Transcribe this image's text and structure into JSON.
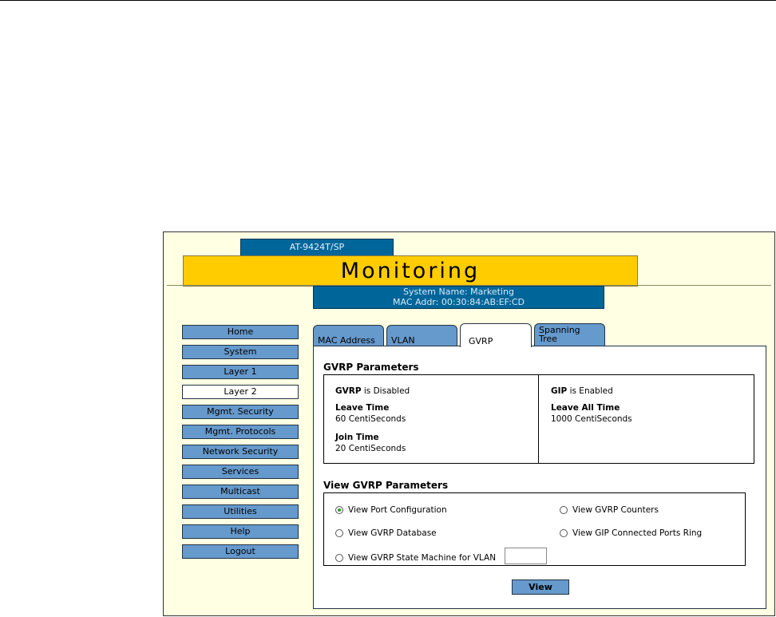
{
  "header": {
    "model": "AT-9424T/SP",
    "title": "Monitoring",
    "system_name": "System Name: Marketing",
    "mac_addr": "MAC Addr: 00:30:84:AB:EF:CD"
  },
  "nav": {
    "items": [
      "Home",
      "System",
      "Layer 1",
      "Layer 2",
      "Mgmt. Security",
      "Mgmt. Protocols",
      "Network Security",
      "Services",
      "Multicast",
      "Utilities",
      "Help",
      "Logout"
    ],
    "active": "Layer 2"
  },
  "tabs": {
    "mac_address": "MAC Address",
    "vlan": "VLAN",
    "gvrp": "GVRP",
    "spanning_tree_1": "Spanning",
    "spanning_tree_2": "Tree",
    "active": "GVRP"
  },
  "gvrp_params": {
    "title": "GVRP Parameters",
    "gvrp_label": "GVRP",
    "gvrp_status": "is Disabled",
    "leave_time_label": "Leave Time",
    "leave_time_value": "60 CentiSeconds",
    "join_time_label": "Join Time",
    "join_time_value": "20 CentiSeconds",
    "gip_label": "GIP",
    "gip_status": "is Enabled",
    "leave_all_label": "Leave All Time",
    "leave_all_value": "1000 CentiSeconds"
  },
  "view_params": {
    "title": "View GVRP Parameters",
    "port_config": "View Port Configuration",
    "counters": "View GVRP Counters",
    "database": "View GVRP Database",
    "gip_ring": "View GIP Connected Ports Ring",
    "state_machine": "View GVRP State Machine for VLAN",
    "vlan_value": "",
    "selected": "View Port Configuration",
    "button": "View"
  },
  "colors": {
    "frame_bg": "#ffffe3",
    "title_bg": "#ffcc00",
    "header_blue": "#006699",
    "button_blue": "#6699cc",
    "radio_check": "#2aa02a"
  }
}
